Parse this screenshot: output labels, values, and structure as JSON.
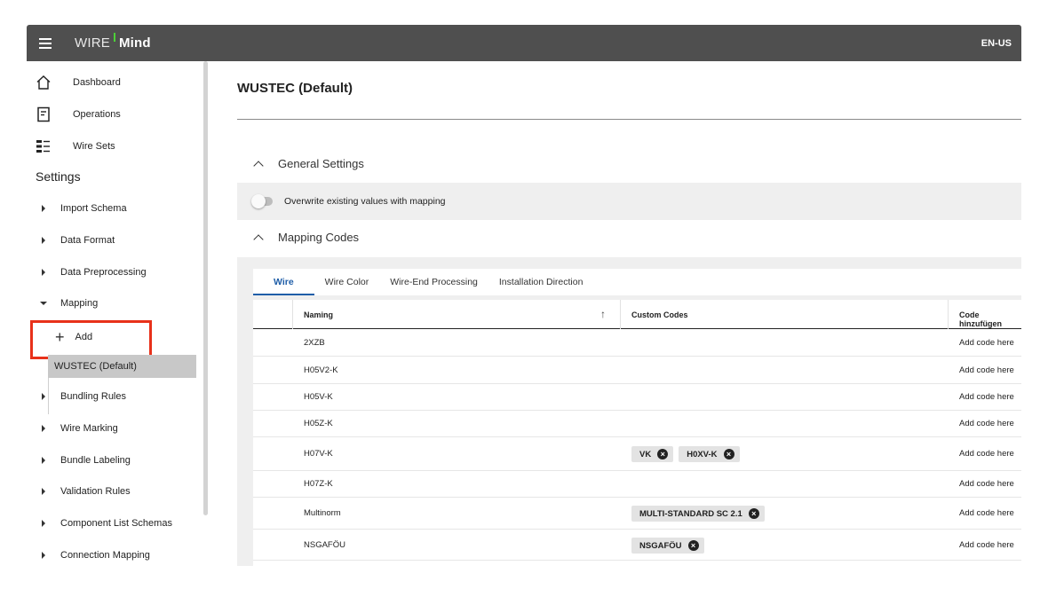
{
  "topbar": {
    "brand_part1": "WIRE",
    "brand_part2": "Mind",
    "language": "EN-US"
  },
  "sidebar": {
    "main_items": [
      {
        "label": "Dashboard",
        "icon": "home-icon"
      },
      {
        "label": "Operations",
        "icon": "document-icon"
      },
      {
        "label": "Wire Sets",
        "icon": "list-icon"
      }
    ],
    "settings_title": "Settings",
    "settings_items": [
      "Import Schema",
      "Data Format",
      "Data Preprocessing",
      "Mapping",
      "Bundling Rules",
      "Wire Marking",
      "Bundle Labeling",
      "Validation Rules",
      "Component List Schemas",
      "Connection Mapping"
    ],
    "mapping_children": {
      "add_label": "Add",
      "active_label": "WUSTEC (Default)"
    }
  },
  "main": {
    "title": "WUSTEC (Default)",
    "general_settings": {
      "heading": "General Settings",
      "toggle_label": "Overwrite existing values with mapping",
      "toggle_on": false
    },
    "mapping_codes": {
      "heading": "Mapping Codes",
      "tabs": [
        "Wire",
        "Wire Color",
        "Wire-End Processing",
        "Installation Direction"
      ],
      "active_tab": "Wire",
      "columns": {
        "naming": "Naming",
        "sort_icon": "↑",
        "custom": "Custom Codes",
        "add": "Code hinzufügen"
      },
      "rows": [
        {
          "naming": "2XZB",
          "codes": [],
          "add": "Add code here"
        },
        {
          "naming": "H05V2-K",
          "codes": [],
          "add": "Add code here"
        },
        {
          "naming": "H05V-K",
          "codes": [],
          "add": "Add code here"
        },
        {
          "naming": "H05Z-K",
          "codes": [],
          "add": "Add code here"
        },
        {
          "naming": "H07V-K",
          "codes": [
            "VK",
            "H0XV-K"
          ],
          "add": "Add code here"
        },
        {
          "naming": "H07Z-K",
          "codes": [],
          "add": "Add code here"
        },
        {
          "naming": "Multinorm",
          "codes": [
            "MULTI-STANDARD SC 2.1"
          ],
          "add": "Add code here"
        },
        {
          "naming": "NSGAFÖU",
          "codes": [
            "NSGAFÖU"
          ],
          "add": "Add code here"
        }
      ]
    }
  },
  "colors": {
    "topbar": "#4f4f4f",
    "accent_blue": "#1f5ea8",
    "highlight_red": "#e8311a",
    "brand_green": "#4cd137"
  }
}
